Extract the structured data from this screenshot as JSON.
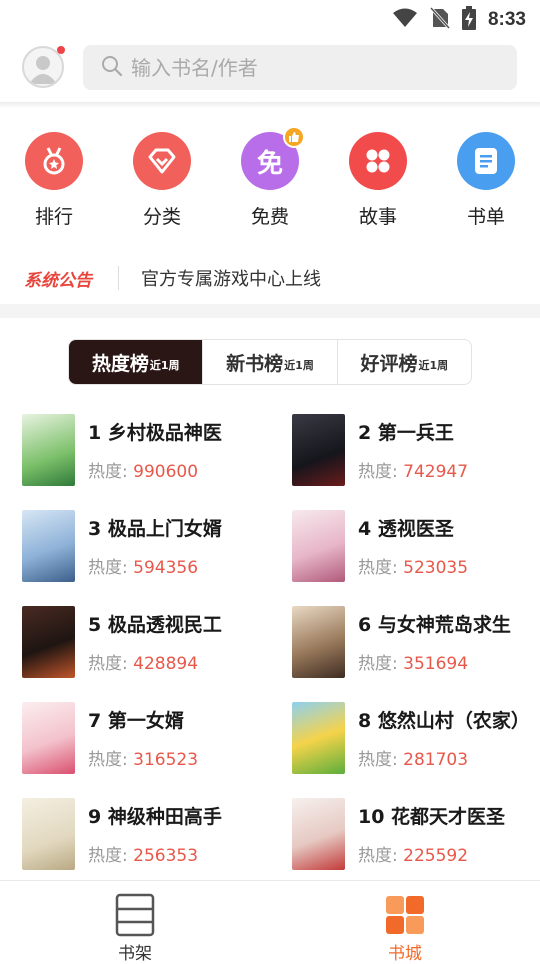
{
  "status_bar": {
    "time": "8:33"
  },
  "header": {
    "search_placeholder": "输入书名/作者"
  },
  "categories": [
    {
      "label": "排行",
      "icon": "medal-icon",
      "color": "#f1605a"
    },
    {
      "label": "分类",
      "icon": "diamond-icon",
      "color": "#f1605a"
    },
    {
      "label": "免费",
      "icon": "free-icon",
      "icon_text": "免",
      "color": "#b76ee8"
    },
    {
      "label": "故事",
      "icon": "grid-icon",
      "color": "#f24b4b"
    },
    {
      "label": "书单",
      "icon": "list-icon",
      "color": "#4a9ef0"
    }
  ],
  "notice": {
    "tag": "系统公告",
    "text": "官方专属游戏中心上线"
  },
  "tabs": [
    {
      "label": "热度榜",
      "sub": "近1周",
      "active": true
    },
    {
      "label": "新书榜",
      "sub": "近1周",
      "active": false
    },
    {
      "label": "好评榜",
      "sub": "近1周",
      "active": false
    }
  ],
  "heat_label": "热度: ",
  "books": [
    {
      "title": "1 乡村极品神医",
      "heat": "990600"
    },
    {
      "title": "2 第一兵王",
      "heat": "742947"
    },
    {
      "title": "3 极品上门女婿",
      "heat": "594356"
    },
    {
      "title": "4 透视医圣",
      "heat": "523035"
    },
    {
      "title": "5 极品透视民工",
      "heat": "428894"
    },
    {
      "title": "6 与女神荒岛求生",
      "heat": "351694"
    },
    {
      "title": "7 第一女婿",
      "heat": "316523"
    },
    {
      "title": "8 悠然山村（农家）",
      "heat": "281703"
    },
    {
      "title": "9 神级种田高手",
      "heat": "256353"
    },
    {
      "title": "10 花都天才医圣",
      "heat": "225592"
    }
  ],
  "bottom_nav": [
    {
      "label": "书架",
      "active": false
    },
    {
      "label": "书城",
      "active": true
    }
  ]
}
